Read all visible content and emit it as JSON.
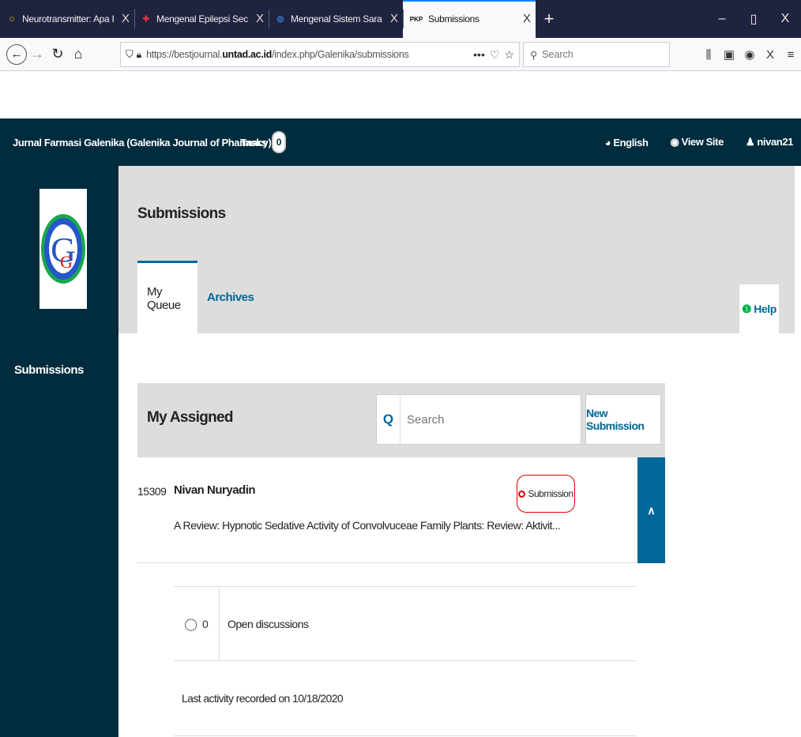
{
  "browser": {
    "tabs": [
      {
        "title": "Neurotransmitter: Apa Itu Mer",
        "favicon": "person-icon"
      },
      {
        "title": "Mengenal Epilepsi Secara Tepat",
        "favicon": "medical-icon"
      },
      {
        "title": "Mengenal Sistem Saraf Manusi",
        "favicon": "brain-icon"
      },
      {
        "title": "Submissions",
        "favicon_text": "PKP",
        "active": true
      }
    ],
    "tab_close": "X",
    "new_tab": "+",
    "url": {
      "prefix": "https://bestjournal.",
      "domain": "untad.ac.id",
      "suffix": "/index.php/Galenika/submissions"
    },
    "search_placeholder": "Search",
    "window_controls": {
      "minimize": "–",
      "maximize": "▯",
      "close": "X"
    }
  },
  "header": {
    "context": "Jurnal Farmasi Galenika (Galenika Journal of Pharmacy) ...",
    "tasks_label": "Tasks",
    "tasks_count": "0",
    "language": "English",
    "view_site": "View Site",
    "user": "nivan21"
  },
  "sidebar": {
    "items": [
      {
        "label": "Submissions"
      }
    ]
  },
  "page": {
    "title": "Submissions",
    "tabs": [
      {
        "label": "My Queue",
        "active": true
      },
      {
        "label": "Archives"
      }
    ],
    "help": "Help"
  },
  "assigned": {
    "title": "My Assigned",
    "search_placeholder": "Search",
    "new_submission": "New Submission",
    "rows": [
      {
        "id": "15309",
        "author": "Nivan Nuryadin",
        "title": "A Review: Hypnotic Sedative Activity of Convolvuceae Family Plants: Review: Aktivit...",
        "stage": "Submission",
        "stage_color": "#d00000"
      }
    ],
    "details": {
      "discussions_count": "0",
      "discussions_label": "Open discussions",
      "last_activity": "Last activity recorded on 10/18/2020"
    }
  },
  "colors": {
    "header_bg": "#002c3d",
    "link": "#006798",
    "help_icon": "#00b24e"
  }
}
